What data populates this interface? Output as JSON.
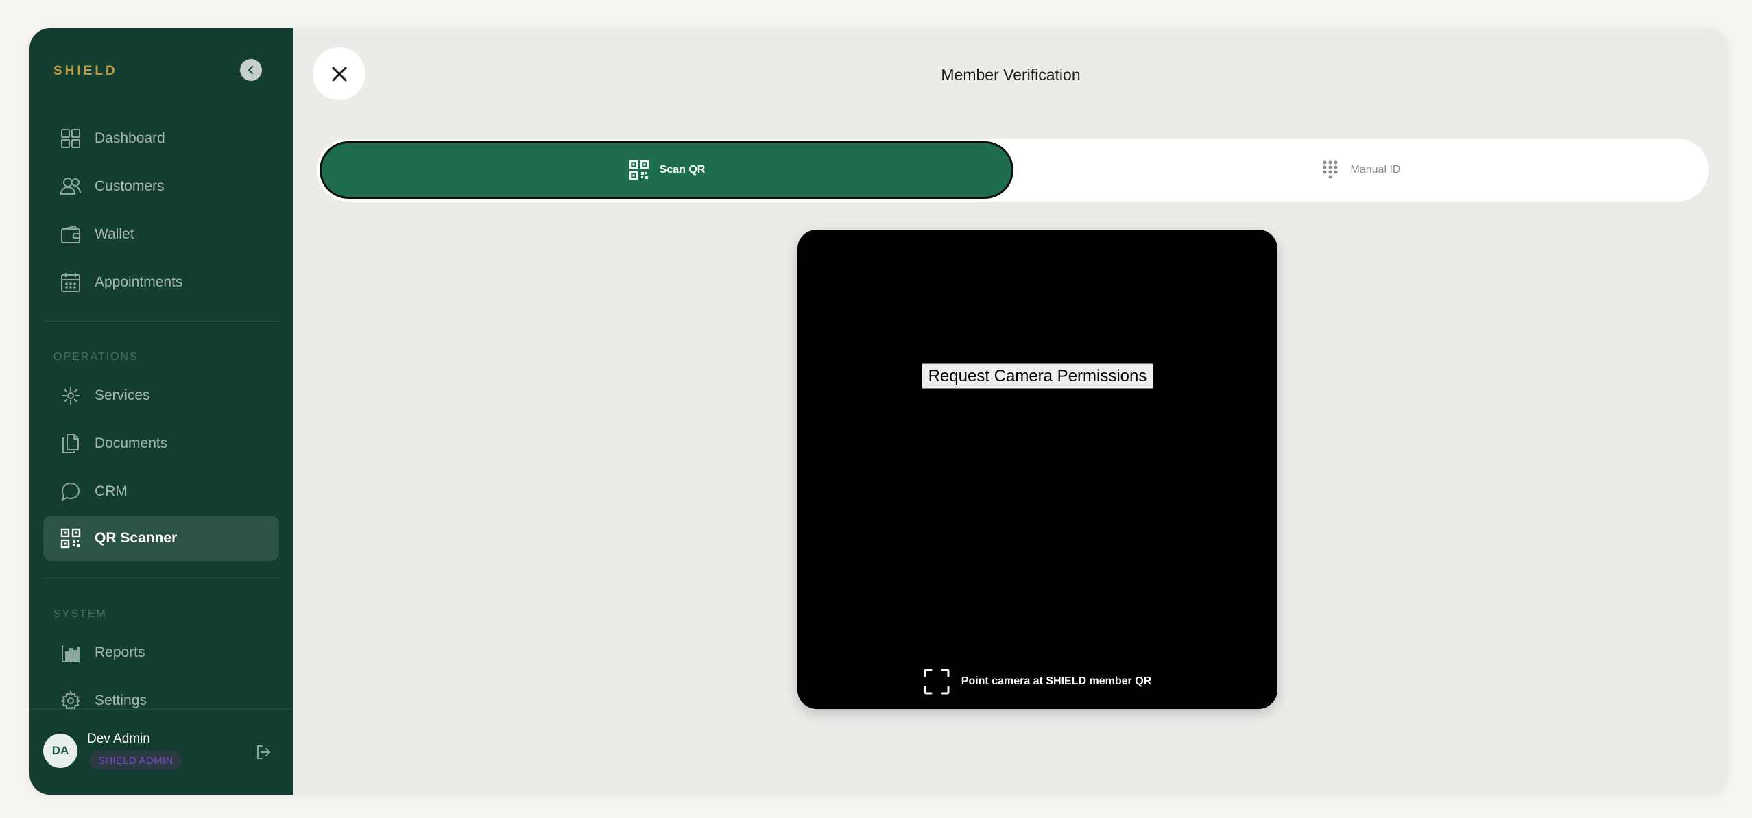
{
  "sidebar": {
    "brand": "SHIELD",
    "main_items": [
      {
        "label": "Dashboard",
        "icon": "dashboard-icon"
      },
      {
        "label": "Customers",
        "icon": "users-icon"
      },
      {
        "label": "Wallet",
        "icon": "wallet-icon"
      },
      {
        "label": "Appointments",
        "icon": "calendar-icon"
      }
    ],
    "operations_label": "OPERATIONS",
    "operations_items": [
      {
        "label": "Services",
        "icon": "services-icon"
      },
      {
        "label": "Documents",
        "icon": "documents-icon"
      },
      {
        "label": "CRM",
        "icon": "chat-icon"
      },
      {
        "label": "QR Scanner",
        "icon": "qr-icon",
        "active": true
      }
    ],
    "system_label": "SYSTEM",
    "system_items": [
      {
        "label": "Reports",
        "icon": "bar-chart-icon"
      },
      {
        "label": "Settings",
        "icon": "gear-icon"
      }
    ],
    "user": {
      "initials": "DA",
      "name": "Dev Admin",
      "role": "SHIELD ADMIN"
    }
  },
  "main": {
    "title": "Member Verification",
    "tabs": [
      {
        "label": "Scan QR",
        "icon": "qr-icon",
        "active": true
      },
      {
        "label": "Manual ID",
        "icon": "keypad-icon",
        "active": false
      }
    ],
    "scanner": {
      "permission_button": "Request Camera Permissions",
      "hint": "Point camera at SHIELD member QR"
    }
  },
  "colors": {
    "sidebar_bg": "#133d30",
    "brand": "#c89b3a",
    "active_tab": "#1e6e4e",
    "role_badge_text": "#7a46c9"
  }
}
